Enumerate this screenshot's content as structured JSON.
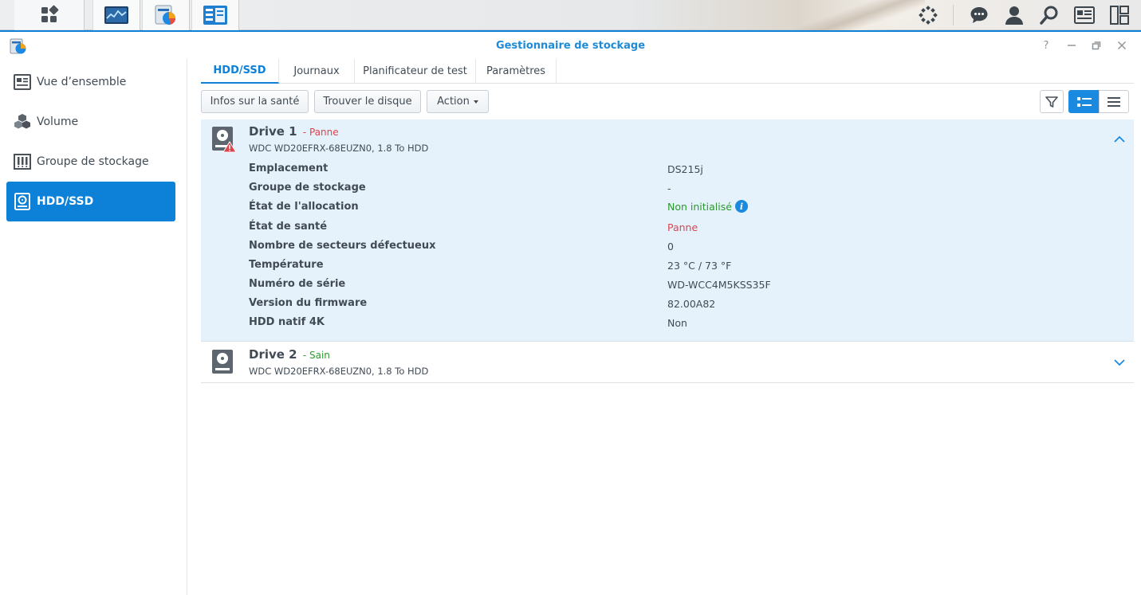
{
  "window": {
    "title": "Gestionnaire de stockage"
  },
  "taskbar": {
    "left_icons": [
      "main-menu-icon",
      "resource-monitor-icon",
      "storage-manager-icon",
      "control-panel-icon"
    ],
    "right_icons": [
      "synology-widgets-icon",
      "chat-icon",
      "user-icon",
      "search-icon",
      "notifications-icon",
      "desktop-layout-icon"
    ]
  },
  "sidebar": {
    "items": [
      {
        "label": "Vue d’ensemble",
        "icon": "overview-icon"
      },
      {
        "label": "Volume",
        "icon": "volume-icon"
      },
      {
        "label": "Groupe de stockage",
        "icon": "storage-pool-icon"
      },
      {
        "label": "HDD/SSD",
        "icon": "hdd-icon",
        "active": true
      }
    ]
  },
  "tabs": [
    {
      "label": "HDD/SSD",
      "active": true
    },
    {
      "label": "Journaux"
    },
    {
      "label": "Planificateur de test"
    },
    {
      "label": "Paramètres"
    }
  ],
  "toolbar": {
    "health_info": "Infos sur la santé",
    "find_disk": "Trouver le disque",
    "action": "Action"
  },
  "drives": [
    {
      "name": "Drive 1",
      "status": "- Panne",
      "model": "WDC WD20EFRX-68EUZN0, 1.8 To HDD",
      "expanded": true,
      "properties": [
        {
          "label": "Emplacement",
          "value": "DS215j"
        },
        {
          "label": "Groupe de stockage",
          "value": "-"
        },
        {
          "label": "État de l'allocation",
          "value": "Non initialisé"
        },
        {
          "label": "État de santé",
          "value": "Panne"
        },
        {
          "label": "Nombre de secteurs défectueux",
          "value": "0"
        },
        {
          "label": "Température",
          "value": "23 °C / 73 °F"
        },
        {
          "label": "Numéro de série",
          "value": "WD-WCC4M5KSS35F"
        },
        {
          "label": "Version du firmware",
          "value": "82.00A82"
        },
        {
          "label": "HDD natif 4K",
          "value": "Non"
        }
      ]
    },
    {
      "name": "Drive 2",
      "status": "- Sain",
      "model": "WDC WD20EFRX-68EUZN0, 1.8 To HDD",
      "expanded": false
    }
  ],
  "colors": {
    "accent": "#0d81d8",
    "error": "#e0434b",
    "ok": "#2a9a2a",
    "selected_row": "#e5f2fc"
  }
}
